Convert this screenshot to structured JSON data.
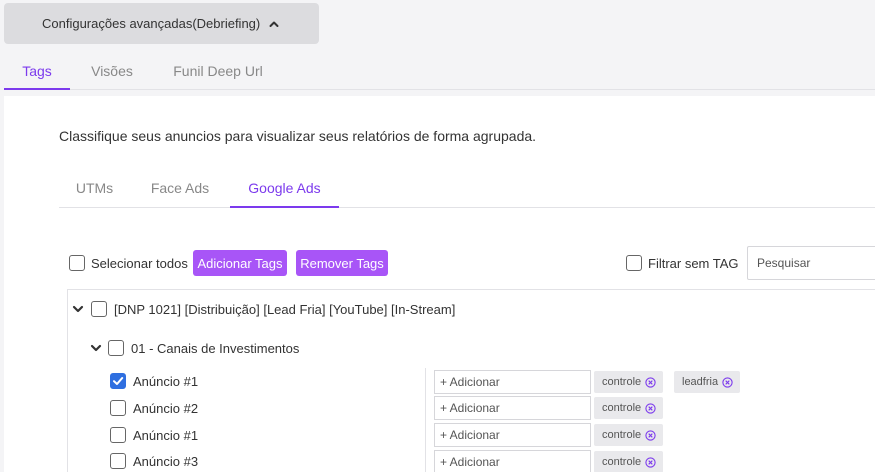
{
  "advanced_button": {
    "label": "Configurações avançadas(Debriefing)",
    "icon": "chevron-up-icon"
  },
  "top_tabs": [
    {
      "label": "Tags",
      "active": true
    },
    {
      "label": "Visões",
      "active": false
    },
    {
      "label": "Funil Deep Url",
      "active": false
    }
  ],
  "description": "Classifique seus anuncios para visualizar seus relatórios de forma agrupada.",
  "sub_tabs": [
    {
      "label": "UTMs",
      "active": false
    },
    {
      "label": "Face Ads",
      "active": false
    },
    {
      "label": "Google Ads",
      "active": true
    }
  ],
  "toolbar": {
    "select_all_label": "Selecionar todos",
    "add_tags_label": "Adicionar Tags",
    "remove_tags_label": "Remover Tags",
    "filter_no_tag_label": "Filtrar sem TAG",
    "search_placeholder": "Pesquisar"
  },
  "tree": {
    "campaign": {
      "label": "[DNP 1021] [Distribuição] [Lead Fria] [YouTube] [In-Stream]",
      "checked": false,
      "expanded": true
    },
    "group": {
      "label": "01 - Canais de Investimentos",
      "checked": false,
      "expanded": true
    },
    "ads": [
      {
        "label": "Anúncio #1",
        "checked": true,
        "add_label": "+ Adicionar",
        "tags": [
          "controle",
          "leadfria"
        ]
      },
      {
        "label": "Anúncio #2",
        "checked": false,
        "add_label": "+ Adicionar",
        "tags": [
          "controle"
        ]
      },
      {
        "label": "Anúncio #1",
        "checked": false,
        "add_label": "+ Adicionar",
        "tags": [
          "controle"
        ]
      },
      {
        "label": "Anúncio #3",
        "checked": false,
        "add_label": "+ Adicionar",
        "tags": [
          "controle"
        ]
      }
    ]
  },
  "colors": {
    "accent": "#7c3aed",
    "button": "#a855f7",
    "checkbox_checked": "#2f6fe0"
  }
}
